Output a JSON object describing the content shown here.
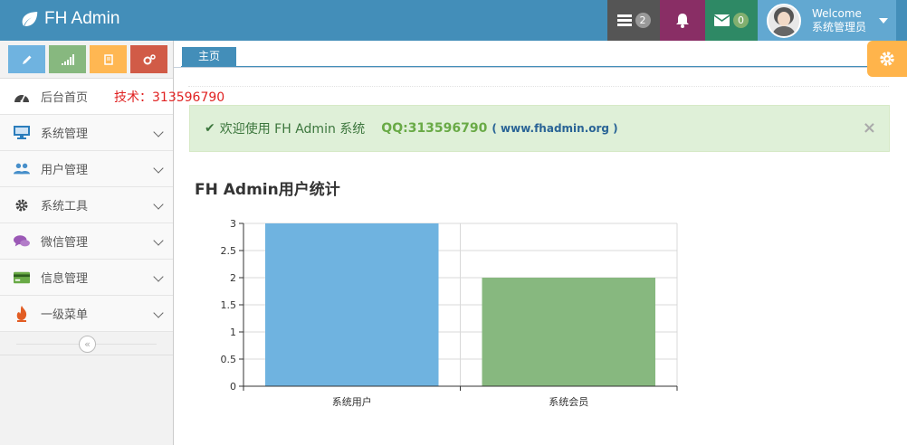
{
  "brand": {
    "name": "FH Admin"
  },
  "navbar": {
    "tasks_count": "2",
    "mail_count": "0",
    "user_greeting": "Welcome",
    "user_name": "系统管理员",
    "colors": {
      "bar": "#438eb9",
      "tasks": "#555555",
      "bell": "#892e65",
      "mail": "#2e8965",
      "user": "#62a8d1"
    }
  },
  "sidebar": {
    "shortcuts": [
      {
        "icon": "pencil-icon"
      },
      {
        "icon": "signal-icon"
      },
      {
        "icon": "book-icon"
      },
      {
        "icon": "cogs-icon"
      }
    ],
    "tech_note": "技术：313596790",
    "items": [
      {
        "label": "后台首页",
        "icon": "tachometer-icon"
      },
      {
        "label": "系统管理",
        "icon": "desktop-icon"
      },
      {
        "label": "用户管理",
        "icon": "users-icon"
      },
      {
        "label": "系统工具",
        "icon": "cog-icon"
      },
      {
        "label": "微信管理",
        "icon": "comments-icon"
      },
      {
        "label": "信息管理",
        "icon": "credit-card-icon"
      },
      {
        "label": "一级菜单",
        "icon": "fire-icon"
      }
    ],
    "collapse_glyph": "«"
  },
  "tabs": [
    {
      "label": "主页"
    }
  ],
  "alert": {
    "check": "✔",
    "text": "欢迎使用 FH Admin 系统",
    "qq": "QQ:313596790",
    "site": "( www.fhadmin.org )",
    "close": "×"
  },
  "chart_title": "FH Admin用户统计",
  "chart_data": {
    "type": "bar",
    "categories": [
      "系统用户",
      "系统会员"
    ],
    "values": [
      3,
      2
    ],
    "colors": [
      "#6fb3e0",
      "#87b87f"
    ],
    "ylim": [
      0,
      3
    ],
    "yticks": [
      "0",
      "0.5",
      "1",
      "1.5",
      "2",
      "2.5",
      "3"
    ],
    "grid": true,
    "legend": "none"
  }
}
